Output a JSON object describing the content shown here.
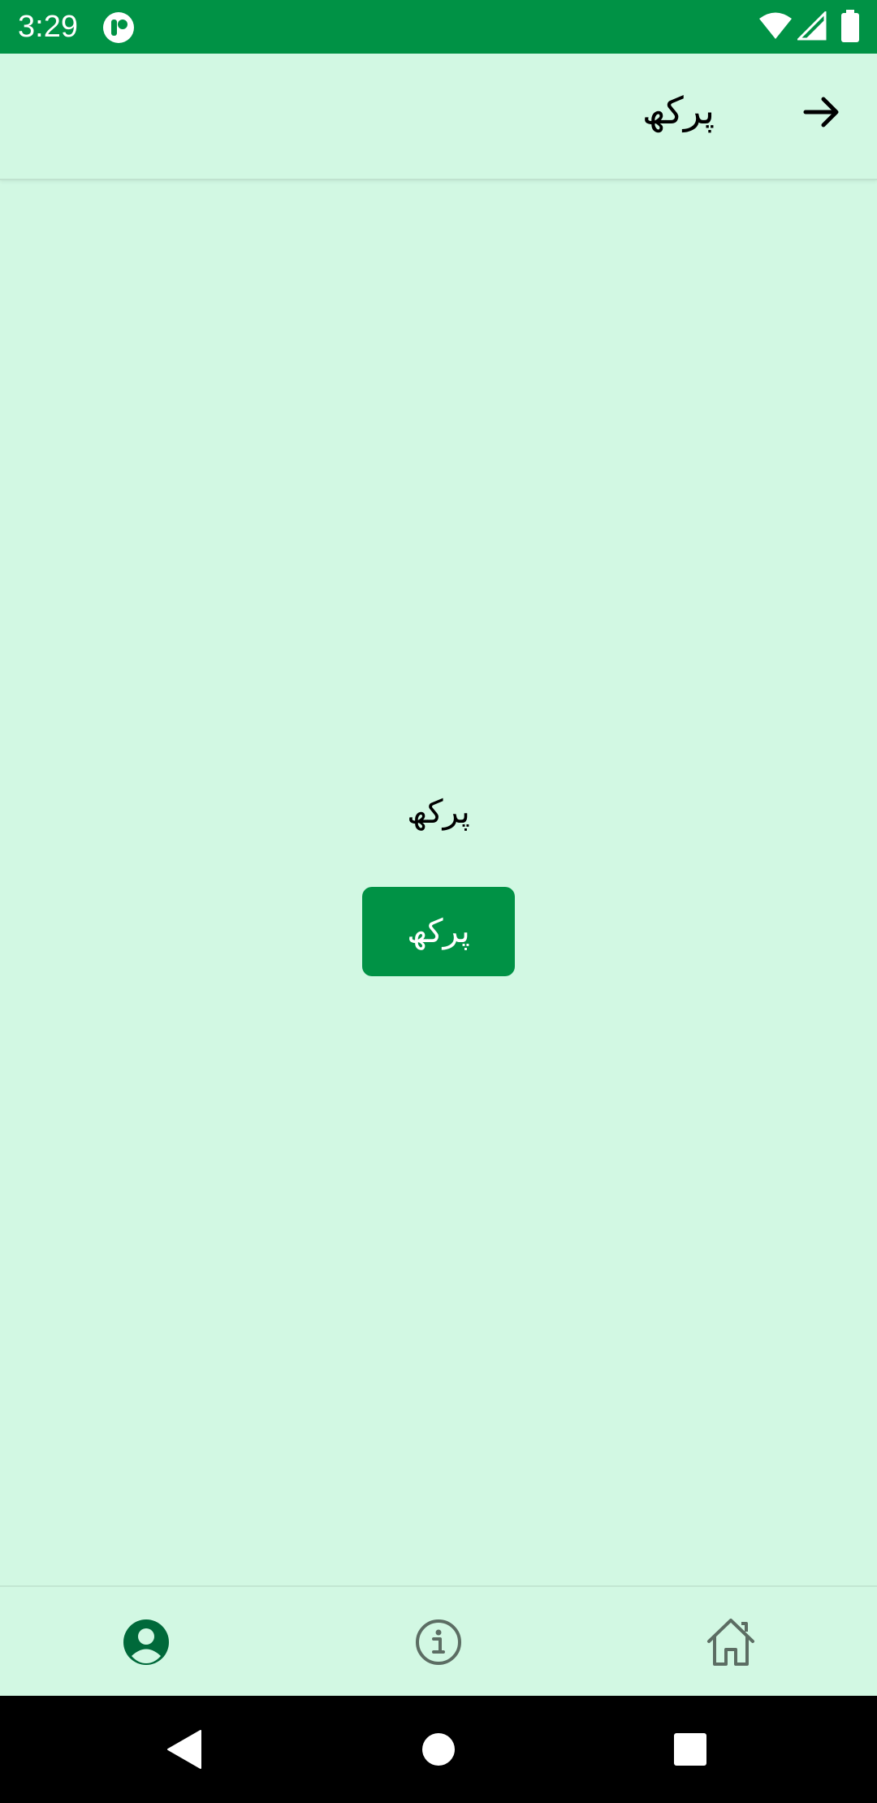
{
  "status_bar": {
    "time": "3:29",
    "icons": [
      "app-notification-icon",
      "wifi-icon",
      "cell-signal-icon",
      "battery-icon"
    ]
  },
  "app_bar": {
    "title": "پرکھ",
    "back_icon": "arrow-right-icon"
  },
  "main": {
    "label": "پرکھ",
    "button_label": "پرکھ"
  },
  "bottom_nav": {
    "items": [
      {
        "icon": "account-circle-icon",
        "selected": true
      },
      {
        "icon": "info-icon",
        "selected": false
      },
      {
        "icon": "home-icon",
        "selected": false
      }
    ]
  },
  "system_nav": {
    "buttons": [
      "back-triangle-icon",
      "home-circle-icon",
      "recents-square-icon"
    ]
  },
  "colors": {
    "primary": "#009245",
    "background": "#d2f8e3",
    "selected_icon": "#00693a",
    "unselected_icon": "#5c6d63"
  }
}
